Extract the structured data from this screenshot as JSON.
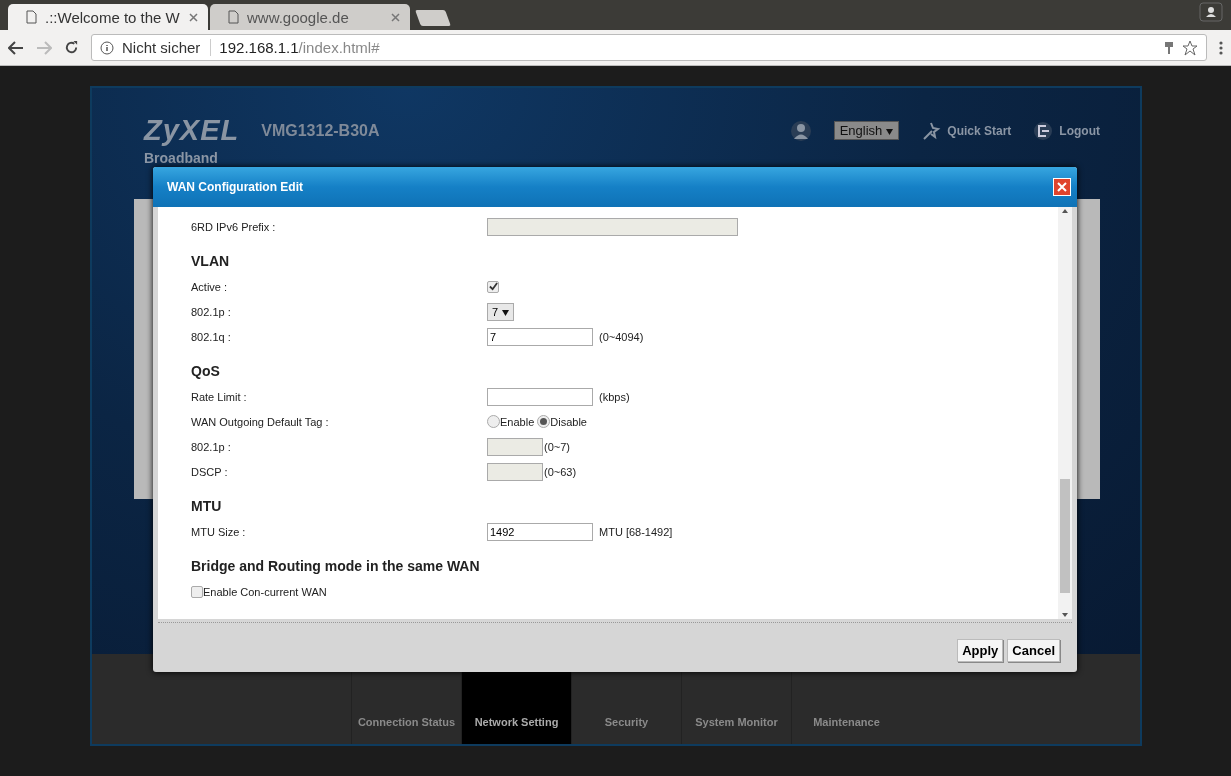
{
  "browser": {
    "tabs": [
      {
        "title": ".::Welcome to the W",
        "selected": true
      },
      {
        "title": "www.google.de",
        "selected": false
      }
    ],
    "security": "Nicht sicher",
    "url_host": "192.168.1.1",
    "url_path": "/index.html#"
  },
  "router": {
    "brand": "ZyXEL",
    "model": "VMG1312-B30A",
    "language": "English",
    "quick_start": "Quick Start",
    "logout": "Logout",
    "page_title": "Broadband",
    "nav": [
      {
        "label": "Connection Status",
        "selected": false
      },
      {
        "label": "Network Setting",
        "selected": true
      },
      {
        "label": "Security",
        "selected": false
      },
      {
        "label": "System Monitor",
        "selected": false
      },
      {
        "label": "Maintenance",
        "selected": false
      }
    ]
  },
  "dialog": {
    "title": "WAN Configuration Edit",
    "sections": [
      {
        "rows": [
          {
            "kind": "wide_input",
            "label": "6RD IPv6 Prefix :",
            "disabled": true
          }
        ]
      },
      {
        "title": "VLAN",
        "rows": [
          {
            "kind": "checkbox",
            "label": "Active :",
            "checked": true
          },
          {
            "kind": "select",
            "label": "802.1p :",
            "value": "7"
          },
          {
            "kind": "input",
            "label": "802.1q :",
            "value": "7",
            "disabled": false,
            "suffix": "(0~4094)"
          }
        ]
      },
      {
        "title": "QoS",
        "rows": [
          {
            "kind": "input",
            "label": "Rate Limit :",
            "disabled": false,
            "suffix": "(kbps)"
          },
          {
            "kind": "radio",
            "label": "WAN Outgoing Default Tag :",
            "options": [
              {
                "label": "Enable",
                "selected": false
              },
              {
                "label": "Disable",
                "selected": true
              }
            ]
          },
          {
            "kind": "short_input",
            "label": "802.1p :",
            "disabled": true,
            "suffix": "(0~7)"
          },
          {
            "kind": "short_input",
            "label": "DSCP :",
            "disabled": true,
            "suffix": "(0~63)"
          }
        ]
      },
      {
        "title": "MTU",
        "rows": [
          {
            "kind": "input",
            "label": "MTU Size :",
            "value": "1492",
            "disabled": false,
            "suffix": "MTU [68-1492]"
          }
        ]
      },
      {
        "title": "Bridge and Routing mode in the same WAN",
        "rows": [
          {
            "kind": "check",
            "label": "Enable Con-current WAN",
            "checked": false
          }
        ]
      }
    ],
    "buttons": [
      "Apply",
      "Cancel"
    ]
  }
}
